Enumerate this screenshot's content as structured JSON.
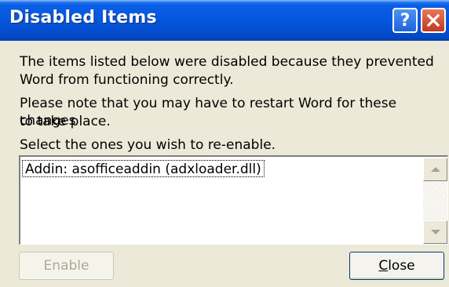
{
  "window": {
    "title": "Disabled Items",
    "help_glyph": "?",
    "close_icon": "close-icon"
  },
  "messages": [
    "The items listed below were disabled because they prevented",
    "Word from functioning correctly.",
    "Please note that you may have to restart Word for these changes",
    "to take place.",
    "Select the ones you wish to re-enable."
  ],
  "list": {
    "items": [
      "Addin: asofficeaddin (adxloader.dll)"
    ]
  },
  "buttons": {
    "enable": "Enable",
    "close_mnemonic": "C",
    "close_rest": "lose"
  },
  "colors": {
    "titlebar": "#0556DC",
    "dialog_bg": "#ECE9D8",
    "close_button": "#C2391C"
  }
}
